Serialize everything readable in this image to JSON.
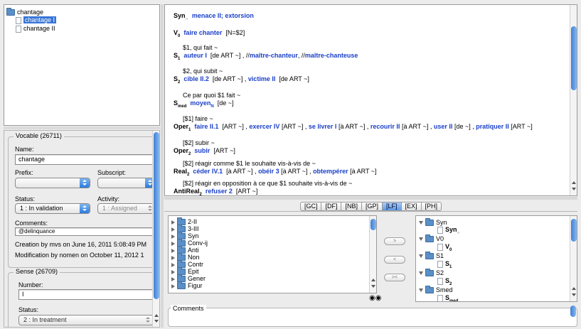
{
  "tree": {
    "root": "chantage",
    "children": [
      "chantage I",
      "chantage II"
    ]
  },
  "vocable": {
    "title": "Vocable (26711)",
    "name_label": "Name:",
    "name_value": "chantage",
    "prefix_label": "Prefix:",
    "subscript_label": "Subscript:",
    "status_label": "Status:",
    "status_value": "1 : In validation",
    "activity_label": "Activity:",
    "activity_value": "1 : Assigned",
    "comments_label": "Comments:",
    "comments_value": "@delinquance",
    "creation": "Creation by mvs on June 16, 2011 5:08:49 PM",
    "modification": "Modification by nomen on October 11, 2012 1"
  },
  "sense": {
    "title": "Sense (26709)",
    "number_label": "Number:",
    "number_value": "I",
    "status_label": "Status:",
    "status_value": "2 : In treatment"
  },
  "lf": {
    "syn": {
      "name": "Syn",
      "sub": "∩",
      "values": "menace II; extorsion"
    },
    "v0": {
      "name": "V",
      "sub": "0",
      "values": "faire chanter",
      "rest": "[N=$2]"
    },
    "s1": {
      "gloss": "$1, qui fait ~",
      "name": "S",
      "sub": "1",
      "v1": "auteur I",
      "r1": "[de ART ~] , //",
      "v2": "maître-chanteur",
      "r2": ", //",
      "v3": "maître-chanteuse"
    },
    "s2": {
      "gloss": "$2, qui subit ~",
      "name": "S",
      "sub": "2",
      "v1": "cible II.2",
      "r1": "[de ART ~] , ",
      "v2": "victime II",
      "r2": "[de ART ~]"
    },
    "smed": {
      "gloss": "Ce par quoi $1 fait ~",
      "name": "S",
      "sub": "med",
      "v1": "moyen",
      "v1sub": "N",
      "r1": "[de ~]"
    },
    "oper1": {
      "gloss": "[$1] faire ~",
      "name": "Oper",
      "sub": "1",
      "v1": "faire II.1",
      "r1": "[ART ~] ,",
      "v2": "exercer IV",
      "r2": "[ART ~] ,",
      "v3": "se livrer I",
      "r3": "[à ART ~] ,",
      "v4": "recourir II",
      "r4": "[à ART ~] ,",
      "v5": "user II",
      "r5": "[de ~] ,",
      "v6": "pratiquer II",
      "r6": "[ART ~]"
    },
    "oper2": {
      "gloss": "[$2] subir ~",
      "name": "Oper",
      "sub": "2",
      "v1": "subir",
      "r1": "[ART ~]"
    },
    "real2": {
      "gloss": "[$2] réagir comme $1 le souhaite vis-à-vis de ~",
      "name": "Real",
      "sub": "2",
      "v1": "céder IV.1",
      "r1": "[à ART ~] ,",
      "v2": "obéir 3",
      "r2": "[à ART ~] ,",
      "v3": "obtempérer",
      "r3": "[à ART ~]"
    },
    "antireal2": {
      "gloss": "[$2] réagir en opposition à ce que $1 souhaite vis-à-vis de ~",
      "name": "AntiReal",
      "sub": "2",
      "v1": "refuser 2",
      "r1": "[ART ~]"
    }
  },
  "tabs": [
    "[GC]",
    "[DF]",
    "[NB]",
    "[GP]",
    "[LF]",
    "[EX]",
    "[PH]"
  ],
  "lf_list": [
    "2-II",
    "3-III",
    "Syn",
    "Conv-ij",
    "Anti",
    "Non",
    "Contr",
    "Epit",
    "Gener",
    "Figur"
  ],
  "move_buttons": [
    ">",
    "<",
    "><"
  ],
  "lf_tree": [
    {
      "folder": "Syn",
      "doc": "Syn",
      "doc_sub": "∩"
    },
    {
      "folder": "V0",
      "doc": "V",
      "doc_sub": "0"
    },
    {
      "folder": "S1",
      "doc": "S",
      "doc_sub": "1"
    },
    {
      "folder": "S2",
      "doc": "S",
      "doc_sub": "2"
    },
    {
      "folder": "Smed",
      "doc": "S",
      "doc_sub": "med"
    }
  ],
  "bottom_comments": "Comments",
  "colors": {
    "link_blue": "#1a3fc8",
    "selection": "#3875d7"
  }
}
